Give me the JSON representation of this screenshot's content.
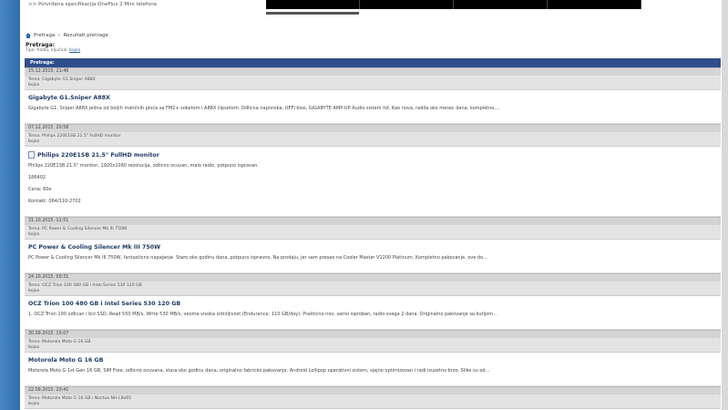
{
  "top": {
    "link": ">> Potvrđena specifikacija OnePlus 2 Mini telefona"
  },
  "breadcrumb": {
    "home": "Pretraga",
    "current": "Rezultati pretrage"
  },
  "heading": "Pretraga:",
  "subhead": {
    "prefix": "Tipe: Radiu, ključnik:",
    "user": "bojsa"
  },
  "results_header": "Pretraga:",
  "posts": [
    {
      "date": "15.12.2015.     21:46",
      "topic": "Tema: Gigabyte G1.Sniper A88X",
      "user": "bojsa",
      "title": "Gigabyte G1.Sniper A88X",
      "body": [
        "Gigabyte G1. Sniper A88X jedna od boljih matičnih ploča sa FM2+ soketom i A88X čipsetom. Odlicna naponska, UEFI bios, GIGABYTE AMP-UP Audio sistem itd. Kao nova, radila oko mesec dana, kompletno...."
      ]
    },
    {
      "date": "07.12.2015.     20:58",
      "topic": "Tema: Philips 220E1SB 21.5\" FullHD monitor",
      "user": "bojsa",
      "title": "Philips 220E1SB 21.5\" FullHD monitor",
      "body": [
        "Philips 220E1SB 21.5\" monitor, 1920x1080 rezolucija, odlicno ocuvan, malo radio, potpuno ispravan.",
        "186402",
        "Cena: 60e",
        "Kontakt: 064/110-2702"
      ]
    },
    {
      "date": "31.10.2015.     11:51",
      "topic": "Tema: PC Power & Cooling Silencer Mk III 750W",
      "user": "bojsa",
      "title": "PC Power & Cooling Silencer Mk III 750W",
      "body": [
        "PC Power & Cooling Silencer Mk III 750W, fantasticno napajanje. Staro oko godinu dana, potpuno ispravno. Na prodaju, jer sam presao na Cooler Master V1200 Platinum. Kompletno pakovanje, ove do..."
      ]
    },
    {
      "date": "24.10.2015.     00:31",
      "topic": "Tema: OCZ Trion 100 480 GB i Intel Series 530 120 GB",
      "user": "bojsa",
      "title": "OCZ Trion 100 480 GB i Intel Series 530 120 GB",
      "body": [
        "1. OCZ Trion 100 odlican i brz SSD. Read 550 MB/s, Write 530 MB/s, veoma visoka izdrzljivost (Endurance: 110 GB/day). Prakticno nov, samo isproban, radio svega 2 dana. Originalno pakovanje sa kutijom..."
      ]
    },
    {
      "date": "30.09.2015.     10:07",
      "topic": "Tema: Motorola Moto G 16 GB",
      "user": "bojsa",
      "title": "Motorola Moto G 16 GB",
      "body": [
        "Motorola Moto G 1st Gen 16 GB, SIM Free, odlicno ocuvana, stara oko godinu dana, originalno fabricko pakovanje. Android Lollipop operativni sistem, sjajno optimizovan i radi izuzetno brzo. Slike su od..."
      ]
    },
    {
      "date": "22.09.2015.     20:41",
      "topic": "Tema: Motorola Moto G 16 GB i Noctua NH-L9x65",
      "user": "bojsa",
      "title": "Motorola Moto G 16 GB i Noctua NH-L9x65",
      "body": []
    }
  ]
}
